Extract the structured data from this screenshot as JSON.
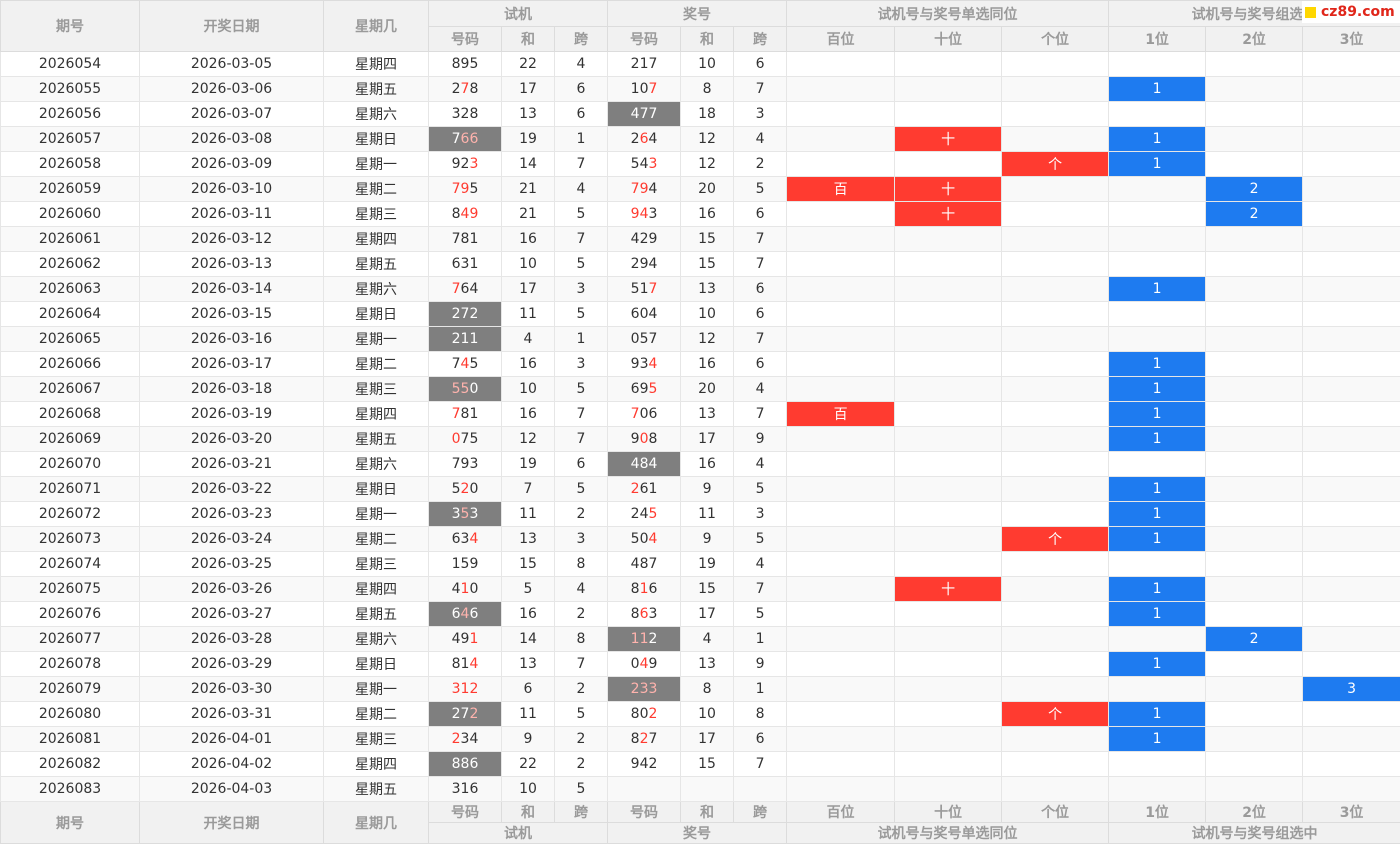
{
  "headers": {
    "issue": "期号",
    "date": "开奖日期",
    "weekday": "星期几",
    "trial": "试机",
    "prize": "奖号",
    "single_pos": "试机号与奖号单选同位",
    "group_pos": "试机号与奖号组选中",
    "code": "号码",
    "sum": "和",
    "span": "跨",
    "hundreds": "百位",
    "tens": "十位",
    "ones": "个位",
    "pos1": "1位",
    "pos2": "2位",
    "pos3": "3位"
  },
  "logo": {
    "text": "cz89.com"
  },
  "rows": [
    {
      "issue": "2026054",
      "date": "2026-03-05",
      "weekday": "星期四",
      "t": [
        "8",
        "9",
        "5"
      ],
      "tr": [
        0,
        0,
        0
      ],
      "td": false,
      "ts": "22",
      "tk": "4",
      "p": [
        "2",
        "1",
        "7"
      ],
      "pr": [
        0,
        0,
        0
      ],
      "pd": false,
      "ps": "10",
      "pk": "6",
      "s": [
        "",
        "",
        ""
      ],
      "g": [
        "",
        "",
        ""
      ]
    },
    {
      "issue": "2026055",
      "date": "2026-03-06",
      "weekday": "星期五",
      "t": [
        "2",
        "7",
        "8"
      ],
      "tr": [
        0,
        1,
        0
      ],
      "td": false,
      "ts": "17",
      "tk": "6",
      "p": [
        "1",
        "0",
        "7"
      ],
      "pr": [
        0,
        0,
        1
      ],
      "pd": false,
      "ps": "8",
      "pk": "7",
      "s": [
        "",
        "",
        ""
      ],
      "g": [
        "1",
        "",
        ""
      ]
    },
    {
      "issue": "2026056",
      "date": "2026-03-07",
      "weekday": "星期六",
      "t": [
        "3",
        "2",
        "8"
      ],
      "tr": [
        0,
        0,
        0
      ],
      "td": false,
      "ts": "13",
      "tk": "6",
      "p": [
        "4",
        "7",
        "7"
      ],
      "pr": [
        0,
        0,
        0
      ],
      "pd": true,
      "ps": "18",
      "pk": "3",
      "s": [
        "",
        "",
        ""
      ],
      "g": [
        "",
        "",
        ""
      ]
    },
    {
      "issue": "2026057",
      "date": "2026-03-08",
      "weekday": "星期日",
      "t": [
        "7",
        "6",
        "6"
      ],
      "tr": [
        0,
        1,
        1
      ],
      "td": true,
      "ts": "19",
      "tk": "1",
      "p": [
        "2",
        "6",
        "4"
      ],
      "pr": [
        0,
        1,
        0
      ],
      "pd": false,
      "ps": "12",
      "pk": "4",
      "s": [
        "",
        "十",
        ""
      ],
      "g": [
        "1",
        "",
        ""
      ]
    },
    {
      "issue": "2026058",
      "date": "2026-03-09",
      "weekday": "星期一",
      "t": [
        "9",
        "2",
        "3"
      ],
      "tr": [
        0,
        0,
        1
      ],
      "td": false,
      "ts": "14",
      "tk": "7",
      "p": [
        "5",
        "4",
        "3"
      ],
      "pr": [
        0,
        0,
        1
      ],
      "pd": false,
      "ps": "12",
      "pk": "2",
      "s": [
        "",
        "",
        "个"
      ],
      "g": [
        "1",
        "",
        ""
      ]
    },
    {
      "issue": "2026059",
      "date": "2026-03-10",
      "weekday": "星期二",
      "t": [
        "7",
        "9",
        "5"
      ],
      "tr": [
        1,
        1,
        0
      ],
      "td": false,
      "ts": "21",
      "tk": "4",
      "p": [
        "7",
        "9",
        "4"
      ],
      "pr": [
        1,
        1,
        0
      ],
      "pd": false,
      "ps": "20",
      "pk": "5",
      "s": [
        "百",
        "十",
        ""
      ],
      "g": [
        "",
        "2",
        ""
      ]
    },
    {
      "issue": "2026060",
      "date": "2026-03-11",
      "weekday": "星期三",
      "t": [
        "8",
        "4",
        "9"
      ],
      "tr": [
        0,
        1,
        1
      ],
      "td": false,
      "ts": "21",
      "tk": "5",
      "p": [
        "9",
        "4",
        "3"
      ],
      "pr": [
        1,
        1,
        0
      ],
      "pd": false,
      "ps": "16",
      "pk": "6",
      "s": [
        "",
        "十",
        ""
      ],
      "g": [
        "",
        "2",
        ""
      ]
    },
    {
      "issue": "2026061",
      "date": "2026-03-12",
      "weekday": "星期四",
      "t": [
        "7",
        "8",
        "1"
      ],
      "tr": [
        0,
        0,
        0
      ],
      "td": false,
      "ts": "16",
      "tk": "7",
      "p": [
        "4",
        "2",
        "9"
      ],
      "pr": [
        0,
        0,
        0
      ],
      "pd": false,
      "ps": "15",
      "pk": "7",
      "s": [
        "",
        "",
        ""
      ],
      "g": [
        "",
        "",
        ""
      ]
    },
    {
      "issue": "2026062",
      "date": "2026-03-13",
      "weekday": "星期五",
      "t": [
        "6",
        "3",
        "1"
      ],
      "tr": [
        0,
        0,
        0
      ],
      "td": false,
      "ts": "10",
      "tk": "5",
      "p": [
        "2",
        "9",
        "4"
      ],
      "pr": [
        0,
        0,
        0
      ],
      "pd": false,
      "ps": "15",
      "pk": "7",
      "s": [
        "",
        "",
        ""
      ],
      "g": [
        "",
        "",
        ""
      ]
    },
    {
      "issue": "2026063",
      "date": "2026-03-14",
      "weekday": "星期六",
      "t": [
        "7",
        "6",
        "4"
      ],
      "tr": [
        1,
        0,
        0
      ],
      "td": false,
      "ts": "17",
      "tk": "3",
      "p": [
        "5",
        "1",
        "7"
      ],
      "pr": [
        0,
        0,
        1
      ],
      "pd": false,
      "ps": "13",
      "pk": "6",
      "s": [
        "",
        "",
        ""
      ],
      "g": [
        "1",
        "",
        ""
      ]
    },
    {
      "issue": "2026064",
      "date": "2026-03-15",
      "weekday": "星期日",
      "t": [
        "2",
        "7",
        "2"
      ],
      "tr": [
        0,
        0,
        0
      ],
      "td": true,
      "ts": "11",
      "tk": "5",
      "p": [
        "6",
        "0",
        "4"
      ],
      "pr": [
        0,
        0,
        0
      ],
      "pd": false,
      "ps": "10",
      "pk": "6",
      "s": [
        "",
        "",
        ""
      ],
      "g": [
        "",
        "",
        ""
      ]
    },
    {
      "issue": "2026065",
      "date": "2026-03-16",
      "weekday": "星期一",
      "t": [
        "2",
        "1",
        "1"
      ],
      "tr": [
        0,
        0,
        0
      ],
      "td": true,
      "ts": "4",
      "tk": "1",
      "p": [
        "0",
        "5",
        "7"
      ],
      "pr": [
        0,
        0,
        0
      ],
      "pd": false,
      "ps": "12",
      "pk": "7",
      "s": [
        "",
        "",
        ""
      ],
      "g": [
        "",
        "",
        ""
      ]
    },
    {
      "issue": "2026066",
      "date": "2026-03-17",
      "weekday": "星期二",
      "t": [
        "7",
        "4",
        "5"
      ],
      "tr": [
        0,
        1,
        0
      ],
      "td": false,
      "ts": "16",
      "tk": "3",
      "p": [
        "9",
        "3",
        "4"
      ],
      "pr": [
        0,
        0,
        1
      ],
      "pd": false,
      "ps": "16",
      "pk": "6",
      "s": [
        "",
        "",
        ""
      ],
      "g": [
        "1",
        "",
        ""
      ]
    },
    {
      "issue": "2026067",
      "date": "2026-03-18",
      "weekday": "星期三",
      "t": [
        "5",
        "5",
        "0"
      ],
      "tr": [
        1,
        1,
        0
      ],
      "td": true,
      "ts": "10",
      "tk": "5",
      "p": [
        "6",
        "9",
        "5"
      ],
      "pr": [
        0,
        0,
        1
      ],
      "pd": false,
      "ps": "20",
      "pk": "4",
      "s": [
        "",
        "",
        ""
      ],
      "g": [
        "1",
        "",
        ""
      ]
    },
    {
      "issue": "2026068",
      "date": "2026-03-19",
      "weekday": "星期四",
      "t": [
        "7",
        "8",
        "1"
      ],
      "tr": [
        1,
        0,
        0
      ],
      "td": false,
      "ts": "16",
      "tk": "7",
      "p": [
        "7",
        "0",
        "6"
      ],
      "pr": [
        1,
        0,
        0
      ],
      "pd": false,
      "ps": "13",
      "pk": "7",
      "s": [
        "百",
        "",
        ""
      ],
      "g": [
        "1",
        "",
        ""
      ]
    },
    {
      "issue": "2026069",
      "date": "2026-03-20",
      "weekday": "星期五",
      "t": [
        "0",
        "7",
        "5"
      ],
      "tr": [
        1,
        0,
        0
      ],
      "td": false,
      "ts": "12",
      "tk": "7",
      "p": [
        "9",
        "0",
        "8"
      ],
      "pr": [
        0,
        1,
        0
      ],
      "pd": false,
      "ps": "17",
      "pk": "9",
      "s": [
        "",
        "",
        ""
      ],
      "g": [
        "1",
        "",
        ""
      ]
    },
    {
      "issue": "2026070",
      "date": "2026-03-21",
      "weekday": "星期六",
      "t": [
        "7",
        "9",
        "3"
      ],
      "tr": [
        0,
        0,
        0
      ],
      "td": false,
      "ts": "19",
      "tk": "6",
      "p": [
        "4",
        "8",
        "4"
      ],
      "pr": [
        0,
        0,
        0
      ],
      "pd": true,
      "ps": "16",
      "pk": "4",
      "s": [
        "",
        "",
        ""
      ],
      "g": [
        "",
        "",
        ""
      ]
    },
    {
      "issue": "2026071",
      "date": "2026-03-22",
      "weekday": "星期日",
      "t": [
        "5",
        "2",
        "0"
      ],
      "tr": [
        0,
        1,
        0
      ],
      "td": false,
      "ts": "7",
      "tk": "5",
      "p": [
        "2",
        "6",
        "1"
      ],
      "pr": [
        1,
        0,
        0
      ],
      "pd": false,
      "ps": "9",
      "pk": "5",
      "s": [
        "",
        "",
        ""
      ],
      "g": [
        "1",
        "",
        ""
      ]
    },
    {
      "issue": "2026072",
      "date": "2026-03-23",
      "weekday": "星期一",
      "t": [
        "3",
        "5",
        "3"
      ],
      "tr": [
        0,
        1,
        0
      ],
      "td": true,
      "ts": "11",
      "tk": "2",
      "p": [
        "2",
        "4",
        "5"
      ],
      "pr": [
        0,
        0,
        1
      ],
      "pd": false,
      "ps": "11",
      "pk": "3",
      "s": [
        "",
        "",
        ""
      ],
      "g": [
        "1",
        "",
        ""
      ]
    },
    {
      "issue": "2026073",
      "date": "2026-03-24",
      "weekday": "星期二",
      "t": [
        "6",
        "3",
        "4"
      ],
      "tr": [
        0,
        0,
        1
      ],
      "td": false,
      "ts": "13",
      "tk": "3",
      "p": [
        "5",
        "0",
        "4"
      ],
      "pr": [
        0,
        0,
        1
      ],
      "pd": false,
      "ps": "9",
      "pk": "5",
      "s": [
        "",
        "",
        "个"
      ],
      "g": [
        "1",
        "",
        ""
      ]
    },
    {
      "issue": "2026074",
      "date": "2026-03-25",
      "weekday": "星期三",
      "t": [
        "1",
        "5",
        "9"
      ],
      "tr": [
        0,
        0,
        0
      ],
      "td": false,
      "ts": "15",
      "tk": "8",
      "p": [
        "4",
        "8",
        "7"
      ],
      "pr": [
        0,
        0,
        0
      ],
      "pd": false,
      "ps": "19",
      "pk": "4",
      "s": [
        "",
        "",
        ""
      ],
      "g": [
        "",
        "",
        ""
      ]
    },
    {
      "issue": "2026075",
      "date": "2026-03-26",
      "weekday": "星期四",
      "t": [
        "4",
        "1",
        "0"
      ],
      "tr": [
        0,
        1,
        0
      ],
      "td": false,
      "ts": "5",
      "tk": "4",
      "p": [
        "8",
        "1",
        "6"
      ],
      "pr": [
        0,
        1,
        0
      ],
      "pd": false,
      "ps": "15",
      "pk": "7",
      "s": [
        "",
        "十",
        ""
      ],
      "g": [
        "1",
        "",
        ""
      ]
    },
    {
      "issue": "2026076",
      "date": "2026-03-27",
      "weekday": "星期五",
      "t": [
        "6",
        "4",
        "6"
      ],
      "tr": [
        0,
        1,
        0
      ],
      "td": true,
      "ts": "16",
      "tk": "2",
      "p": [
        "8",
        "6",
        "3"
      ],
      "pr": [
        0,
        1,
        0
      ],
      "pd": false,
      "ps": "17",
      "pk": "5",
      "s": [
        "",
        "",
        ""
      ],
      "g": [
        "1",
        "",
        ""
      ]
    },
    {
      "issue": "2026077",
      "date": "2026-03-28",
      "weekday": "星期六",
      "t": [
        "4",
        "9",
        "1"
      ],
      "tr": [
        0,
        0,
        1
      ],
      "td": false,
      "ts": "14",
      "tk": "8",
      "p": [
        "1",
        "1",
        "2"
      ],
      "pr": [
        1,
        1,
        0
      ],
      "pd": true,
      "ps": "4",
      "pk": "1",
      "s": [
        "",
        "",
        ""
      ],
      "g": [
        "",
        "2",
        ""
      ]
    },
    {
      "issue": "2026078",
      "date": "2026-03-29",
      "weekday": "星期日",
      "t": [
        "8",
        "1",
        "4"
      ],
      "tr": [
        0,
        0,
        1
      ],
      "td": false,
      "ts": "13",
      "tk": "7",
      "p": [
        "0",
        "4",
        "9"
      ],
      "pr": [
        0,
        1,
        0
      ],
      "pd": false,
      "ps": "13",
      "pk": "9",
      "s": [
        "",
        "",
        ""
      ],
      "g": [
        "1",
        "",
        ""
      ]
    },
    {
      "issue": "2026079",
      "date": "2026-03-30",
      "weekday": "星期一",
      "t": [
        "3",
        "1",
        "2"
      ],
      "tr": [
        1,
        1,
        1
      ],
      "td": false,
      "ts": "6",
      "tk": "2",
      "p": [
        "2",
        "3",
        "3"
      ],
      "pr": [
        1,
        1,
        1
      ],
      "pd": true,
      "ps": "8",
      "pk": "1",
      "s": [
        "",
        "",
        ""
      ],
      "g": [
        "",
        "",
        "3"
      ]
    },
    {
      "issue": "2026080",
      "date": "2026-03-31",
      "weekday": "星期二",
      "t": [
        "2",
        "7",
        "2"
      ],
      "tr": [
        0,
        0,
        1
      ],
      "td": true,
      "ts": "11",
      "tk": "5",
      "p": [
        "8",
        "0",
        "2"
      ],
      "pr": [
        0,
        0,
        1
      ],
      "pd": false,
      "ps": "10",
      "pk": "8",
      "s": [
        "",
        "",
        "个"
      ],
      "g": [
        "1",
        "",
        ""
      ]
    },
    {
      "issue": "2026081",
      "date": "2026-04-01",
      "weekday": "星期三",
      "t": [
        "2",
        "3",
        "4"
      ],
      "tr": [
        1,
        0,
        0
      ],
      "td": false,
      "ts": "9",
      "tk": "2",
      "p": [
        "8",
        "2",
        "7"
      ],
      "pr": [
        0,
        1,
        0
      ],
      "pd": false,
      "ps": "17",
      "pk": "6",
      "s": [
        "",
        "",
        ""
      ],
      "g": [
        "1",
        "",
        ""
      ]
    },
    {
      "issue": "2026082",
      "date": "2026-04-02",
      "weekday": "星期四",
      "t": [
        "8",
        "8",
        "6"
      ],
      "tr": [
        0,
        0,
        0
      ],
      "td": true,
      "ts": "22",
      "tk": "2",
      "p": [
        "9",
        "4",
        "2"
      ],
      "pr": [
        0,
        0,
        0
      ],
      "pd": false,
      "ps": "15",
      "pk": "7",
      "s": [
        "",
        "",
        ""
      ],
      "g": [
        "",
        "",
        ""
      ]
    },
    {
      "issue": "2026083",
      "date": "2026-04-03",
      "weekday": "星期五",
      "t": [
        "3",
        "1",
        "6"
      ],
      "tr": [
        0,
        0,
        0
      ],
      "td": false,
      "ts": "10",
      "tk": "5",
      "p": [
        "",
        "",
        ""
      ],
      "pr": [
        0,
        0,
        0
      ],
      "pd": false,
      "ps": "",
      "pk": "",
      "s": [
        "",
        "",
        ""
      ],
      "g": [
        "",
        "",
        ""
      ]
    }
  ],
  "colors": {
    "match_red": "#ff3b30",
    "group_blue": "#1e7bf0",
    "dark_cell": "#7f7f7f",
    "header_bg": "#f1f1f1"
  }
}
